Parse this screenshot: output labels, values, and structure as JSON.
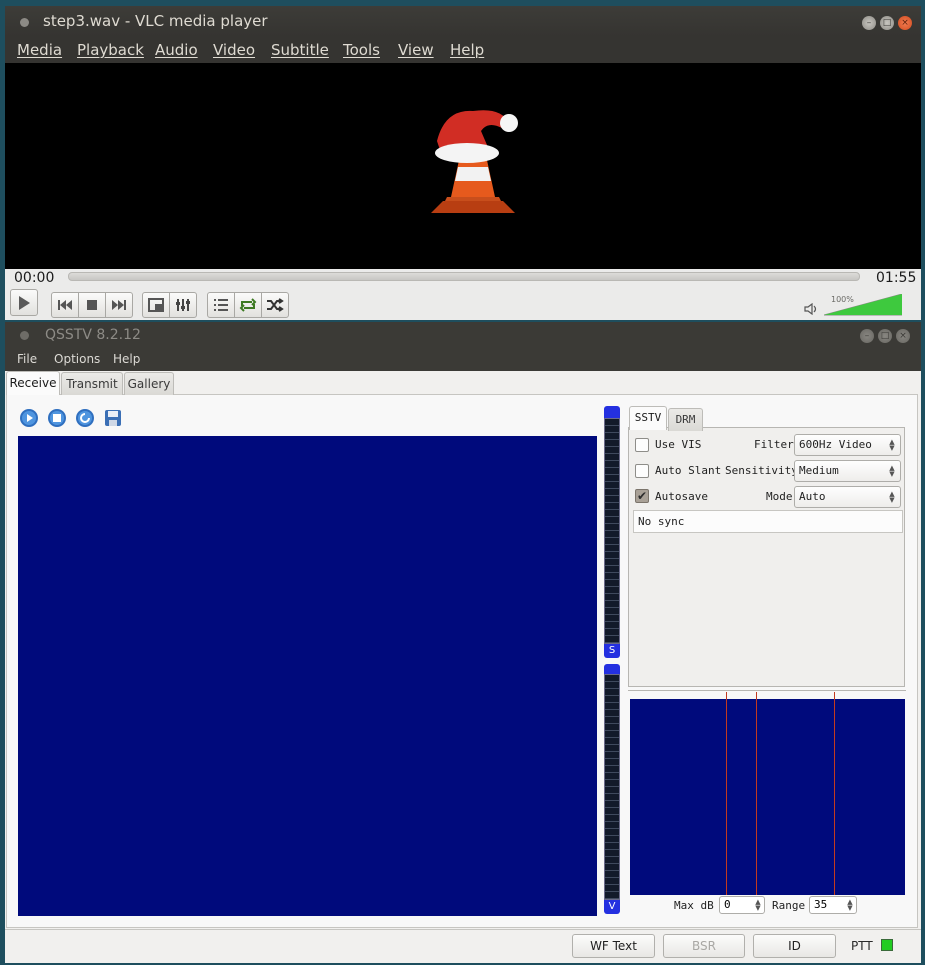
{
  "vlc": {
    "title": "step3.wav - VLC media player",
    "menu": [
      "Media",
      "Playback",
      "Audio",
      "Video",
      "Subtitle",
      "Tools",
      "View",
      "Help"
    ],
    "time_elapsed": "00:00",
    "time_total": "01:55",
    "volume_label": "100%",
    "volume_level": 1.0,
    "seek_progress": 0.0,
    "icons": [
      "play-icon",
      "previous-icon",
      "stop-icon",
      "next-icon",
      "fullscreen-icon",
      "extended-settings-icon",
      "playlist-icon",
      "loop-icon",
      "shuffle-icon",
      "speaker-icon"
    ]
  },
  "qsstv": {
    "title": "QSSTV 8.2.12",
    "menu": [
      "File",
      "Options",
      "Help"
    ],
    "tabs": [
      "Receive",
      "Transmit",
      "Gallery"
    ],
    "mode_tabs": [
      "SSTV",
      "DRM"
    ],
    "use_vis_label": "Use VIS",
    "auto_slant_label": "Auto Slant",
    "autosave_label": "Autosave",
    "use_vis_checked": false,
    "auto_slant_checked": false,
    "autosave_checked": true,
    "filter_label": "Filter",
    "filter_value": "600Hz Video",
    "sensitivity_label": "Sensitivity",
    "sensitivity_value": "Medium",
    "mode_label": "Mode",
    "mode_value": "Auto",
    "sync_status": "No sync",
    "meter_top_label": "S",
    "meter_bottom_label": "V",
    "max_db_label": "Max dB",
    "max_db_value": "0",
    "range_label": "Range",
    "range_value": "35",
    "wf_text_button": "WF Text",
    "bsr_button": "BSR",
    "id_button": "ID",
    "ptt_label": "PTT",
    "colors": {
      "image_bg": "#000a7c",
      "marker": "#c23a1f",
      "ptt_on": "#22cc22"
    }
  }
}
